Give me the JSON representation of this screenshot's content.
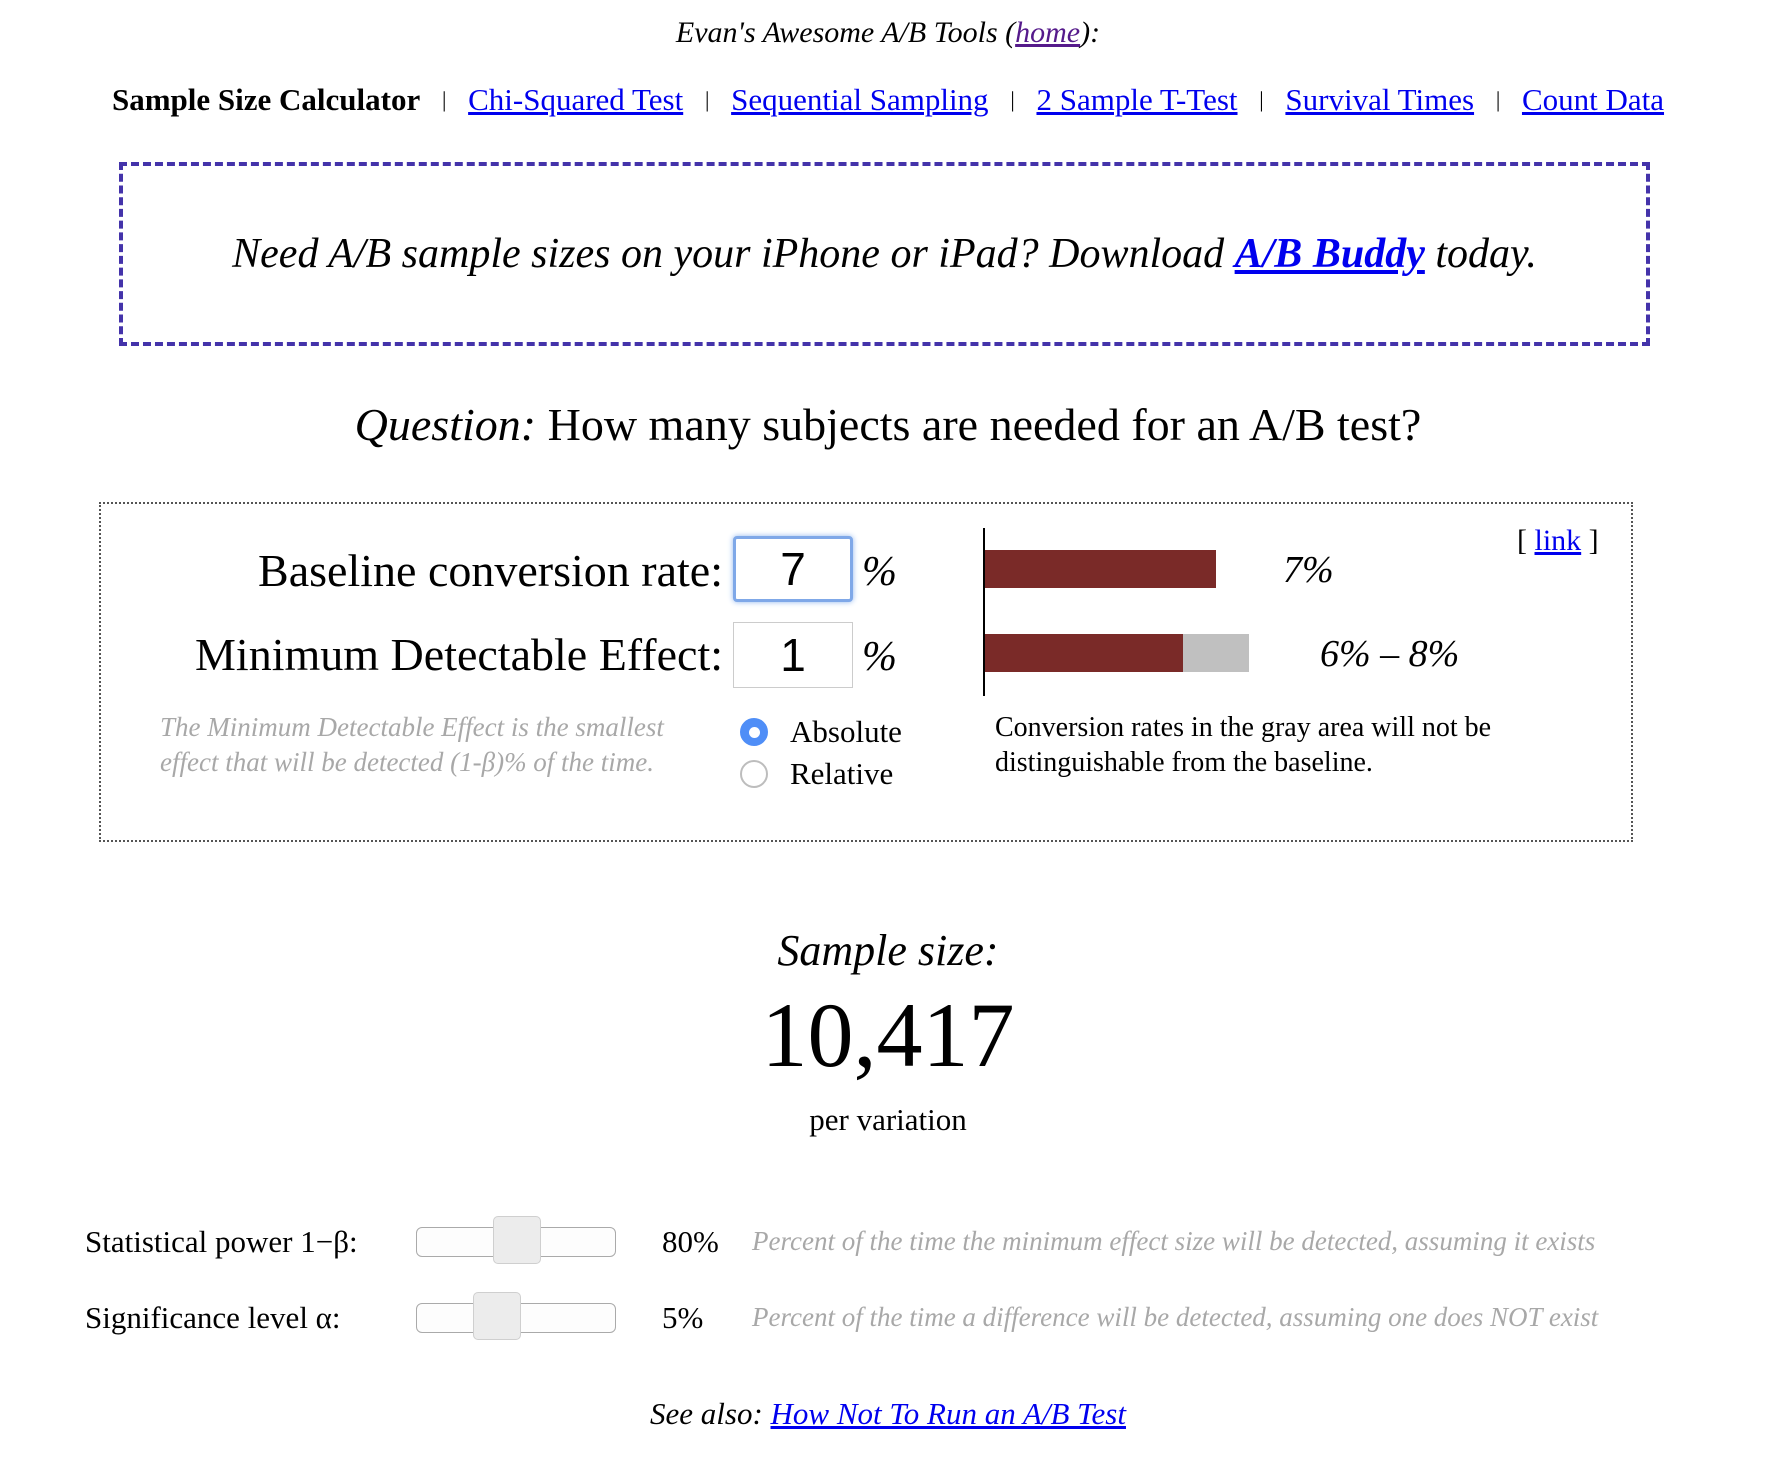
{
  "header": {
    "prefix": "Evan's Awesome A/B Tools (",
    "home_link": "home",
    "suffix": "):"
  },
  "nav": {
    "current": "Sample Size Calculator",
    "separator": "|",
    "links": [
      "Chi-Squared Test",
      "Sequential Sampling",
      "2 Sample T-Test",
      "Survival Times",
      "Count Data"
    ]
  },
  "promo": {
    "prefix": "Need A/B sample sizes on your iPhone or iPad? Download",
    "link": "A/B Buddy",
    "suffix": "today."
  },
  "question": {
    "label": "Question:",
    "text": "How many subjects are needed for an A/B test?"
  },
  "calculator": {
    "baseline": {
      "label": "Baseline conversion rate:",
      "value": "7",
      "unit": "%"
    },
    "mde": {
      "label": "Minimum Detectable Effect:",
      "value": "1",
      "unit": "%"
    },
    "mde_note": "The Minimum Detectable Effect is the smallest effect that will be detected (1-β)% of the time.",
    "mode_options": [
      {
        "label": "Absolute",
        "checked": true
      },
      {
        "label": "Relative",
        "checked": false
      }
    ],
    "permalink": {
      "open": "[",
      "label": "link",
      "close": "]"
    },
    "chart_note": "Conversion rates in the gray area will not be distinguishable from the baseline.",
    "colors": {
      "bar": "#7a2a28",
      "gray_area": "#c0c0c0"
    }
  },
  "chart_data": {
    "type": "bar",
    "axis_scale_percent_full": 10,
    "baseline_percent": 7,
    "range_low_percent": 6,
    "range_high_percent": 8,
    "baseline_label": "7%",
    "range_label": "6% – 8%"
  },
  "result": {
    "title": "Sample size:",
    "value": "10,417",
    "unit": "per variation"
  },
  "sliders": [
    {
      "label": "Statistical power 1−β:",
      "value": "80%",
      "fraction": 0.5,
      "help": "Percent of the time the minimum effect size will be detected, assuming it exists"
    },
    {
      "label": "Significance level α:",
      "value": "5%",
      "fraction": 0.37,
      "help": "Percent of the time a difference will be detected, assuming one does NOT exist"
    }
  ],
  "see_also": {
    "prefix": "See also:",
    "link": "How Not To Run an A/B Test"
  }
}
